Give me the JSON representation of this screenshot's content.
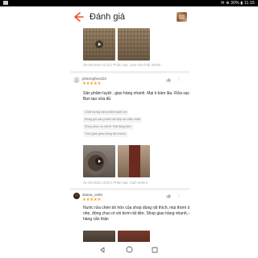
{
  "status_bar": {
    "text": "✉ ⊕ 30% ▮ 11:15"
  },
  "header": {
    "title": "Đánh giá"
  },
  "review_prev": {
    "meta": "25-08-2020 12:34 | Phân loại: Làm như thật 300ml"
  },
  "review_1": {
    "username": "phanngheo234",
    "stars": "★★★★★",
    "text": "Sản phẩm tuyệt , giao hàng nhanh. Mại k bám lâu. Rửa sạch. Bọn tạo vừa đủ",
    "tags": [
      "Chất lượng sản phẩm tuyệt vời",
      "Đóng gói sản phẩm rất đẹp và chắc chắn",
      "Shop phục vụ rất tốt",
      "Rất đáng tiền",
      "Thời gian giao hàng rất nhanh"
    ],
    "meta": "21-08-2020 12:53 | Phân loại: Cafe 500ml"
  },
  "review_2": {
    "username": "duana_order",
    "stars": "★★★★★",
    "text": "Nước rửa chén bồ hòn của shop dùng rất thích, mùi thơm dịu nhẹ, đóng chai có vòi bơm rất tiện. Shop giao hàng nhanh, gói hàng cẩn thận"
  },
  "colors": {
    "accent": "#ee4d2d",
    "star": "#f5a623"
  },
  "icons": {
    "back": "arrow-left-icon",
    "play": "play-icon",
    "like": "thumbs-up-icon",
    "more": "more-vertical-icon"
  }
}
